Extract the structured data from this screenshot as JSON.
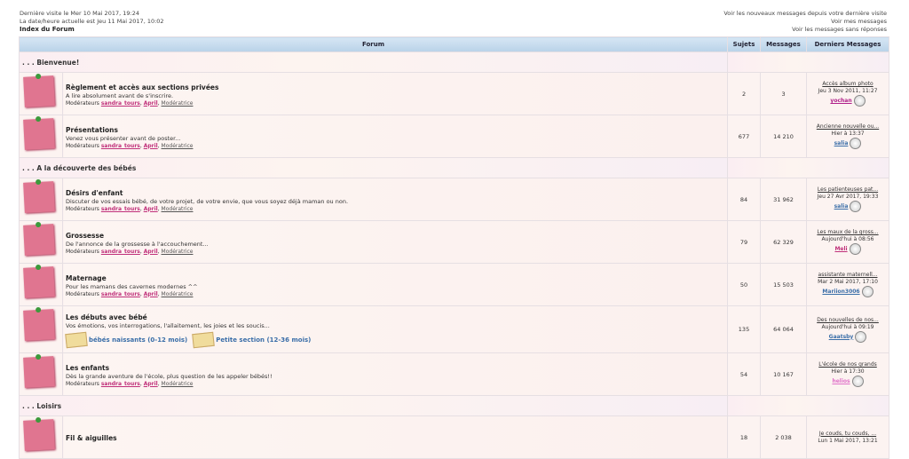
{
  "header": {
    "last_visit": "Dernière visite le Mer 10 Mai 2017, 19:24",
    "current_date": "La date/heure actuelle est Jeu 11 Mai 2017, 10:02",
    "index": "Index du Forum",
    "links": [
      "Voir les nouveaux messages depuis votre dernière visite",
      "Voir mes messages",
      "Voir les messages sans réponses"
    ]
  },
  "columns": [
    "Forum",
    "Sujets",
    "Messages",
    "Derniers Messages"
  ],
  "moderators": {
    "label": "Modérateurs",
    "m1": "sandra_tours",
    "m2": "April",
    "m3": "Modératrice"
  },
  "categories": [
    {
      "title": ". . . Bienvenue!"
    },
    {
      "title": ". . . A la découverte des bébés"
    },
    {
      "title": ". . . Loisirs"
    }
  ],
  "forums": [
    {
      "title": "Règlement et accès aux sections privées",
      "desc": "A lire absolument avant de s'inscrire.",
      "sujets": "2",
      "messages": "3",
      "last_title": "Accès album photo",
      "last_date": "Jeu 3 Nov 2011, 11:27",
      "last_user": "yochan",
      "user_color": "#b0208a"
    },
    {
      "title": "Présentations",
      "desc": "Venez vous présenter avant de poster...",
      "sujets": "677",
      "messages": "14 210",
      "last_title": "Ancienne nouvelle ou...",
      "last_date": "Hier à 13:37",
      "last_user": "salia",
      "user_color": "#3a6ea8"
    },
    {
      "title": "Désirs d'enfant",
      "desc": "Discuter de vos essais bébé, de votre projet, de votre envie, que vous soyez déjà maman ou non.",
      "sujets": "84",
      "messages": "31 962",
      "last_title": "Les patienteuses pat...",
      "last_date": "Jeu 27 Avr 2017, 19:33",
      "last_user": "salia",
      "user_color": "#3a6ea8"
    },
    {
      "title": "Grossesse",
      "desc": "De l'annonce de la grossesse à l'accouchement...",
      "sujets": "79",
      "messages": "62 329",
      "last_title": "Les maux de la gross...",
      "last_date": "Aujourd'hui à 08:56",
      "last_user": "Meli",
      "user_color": "#c0307a"
    },
    {
      "title": "Maternage",
      "desc": "Pour les mamans des cavernes modernes ^^",
      "sujets": "50",
      "messages": "15 503",
      "last_title": "assistante maternell...",
      "last_date": "Mar 2 Mai 2017, 17:10",
      "last_user": "Mariion3006",
      "user_color": "#3a6ea8"
    },
    {
      "title": "Les débuts avec bébé",
      "desc": "Vos émotions, vos interrogations, l'allaitement, les joies et les soucis...",
      "sujets": "135",
      "messages": "64 064",
      "last_title": "Des nouvelles de nos...",
      "last_date": "Aujourd'hui à 09:19",
      "last_user": "Gaatsby",
      "user_color": "#3a6ea8",
      "subforums": [
        "bébés naissants (0-12 mois)",
        "Petite section (12-36 mois)"
      ]
    },
    {
      "title": "Les enfants",
      "desc": "Dès la grande aventure de l'école, plus question de les appeler bébés!!",
      "sujets": "54",
      "messages": "10 167",
      "last_title": "L'école de nos grands",
      "last_date": "Hier à 17:30",
      "last_user": "helios",
      "user_color": "#e070c8"
    },
    {
      "title": "Fil & aiguilles",
      "desc": "",
      "sujets": "18",
      "messages": "2 038",
      "last_title": "Je couds, tu couds, ...",
      "last_date": "Lun 1 Mai 2017, 13:21",
      "last_user": "",
      "user_color": "#333"
    }
  ]
}
